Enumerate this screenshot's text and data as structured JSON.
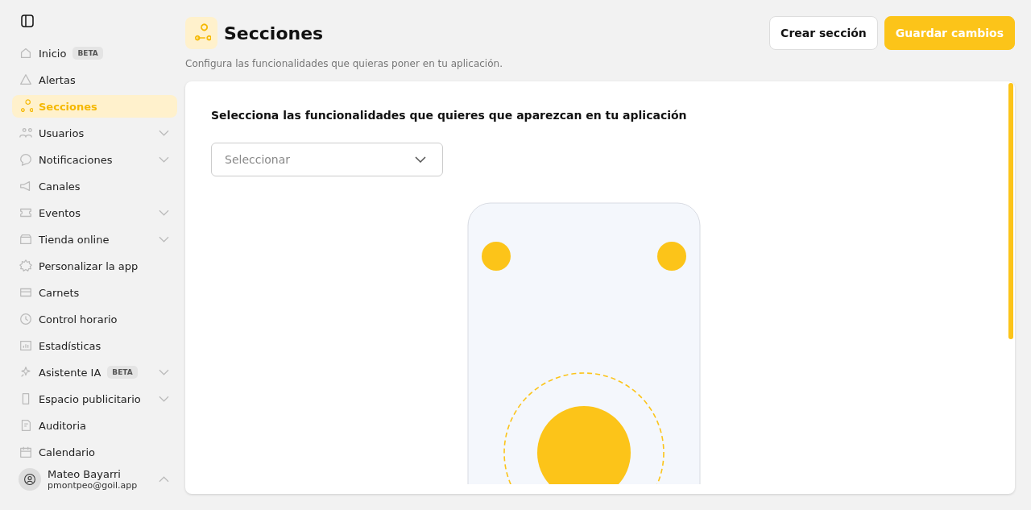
{
  "sidebar": {
    "items": [
      {
        "label": "Inicio",
        "badge": "BETA",
        "selected": false,
        "expandable": false
      },
      {
        "label": "Alertas",
        "selected": false,
        "expandable": false
      },
      {
        "label": "Secciones",
        "selected": true,
        "expandable": false
      },
      {
        "label": "Usuarios",
        "selected": false,
        "expandable": true
      },
      {
        "label": "Notificaciones",
        "selected": false,
        "expandable": true
      },
      {
        "label": "Canales",
        "selected": false,
        "expandable": false
      },
      {
        "label": "Eventos",
        "selected": false,
        "expandable": true
      },
      {
        "label": "Tienda online",
        "selected": false,
        "expandable": true
      },
      {
        "label": "Personalizar la app",
        "selected": false,
        "expandable": false
      },
      {
        "label": "Carnets",
        "selected": false,
        "expandable": false
      },
      {
        "label": "Control horario",
        "selected": false,
        "expandable": false
      },
      {
        "label": "Estadísticas",
        "selected": false,
        "expandable": false
      },
      {
        "label": "Asistente IA",
        "badge": "BETA",
        "selected": false,
        "expandable": true
      },
      {
        "label": "Espacio publicitario",
        "selected": false,
        "expandable": true
      },
      {
        "label": "Auditoria",
        "selected": false,
        "expandable": false
      },
      {
        "label": "Calendario",
        "selected": false,
        "expandable": false
      }
    ],
    "user": {
      "name": "Mateo Bayarri",
      "email": "pmontpeo@goil.app"
    }
  },
  "header": {
    "title": "Secciones",
    "subtitle": "Configura las funcionalidades que quieras poner en tu aplicación.",
    "buttons": [
      {
        "label": "Crear sección",
        "kind": "secondary"
      },
      {
        "label": "Guardar cambios",
        "kind": "primary"
      }
    ]
  },
  "card": {
    "heading": "Selecciona las funcionalidades que quieres que aparezcan en tu aplicación",
    "select": {
      "placeholder": "Seleccionar"
    }
  }
}
